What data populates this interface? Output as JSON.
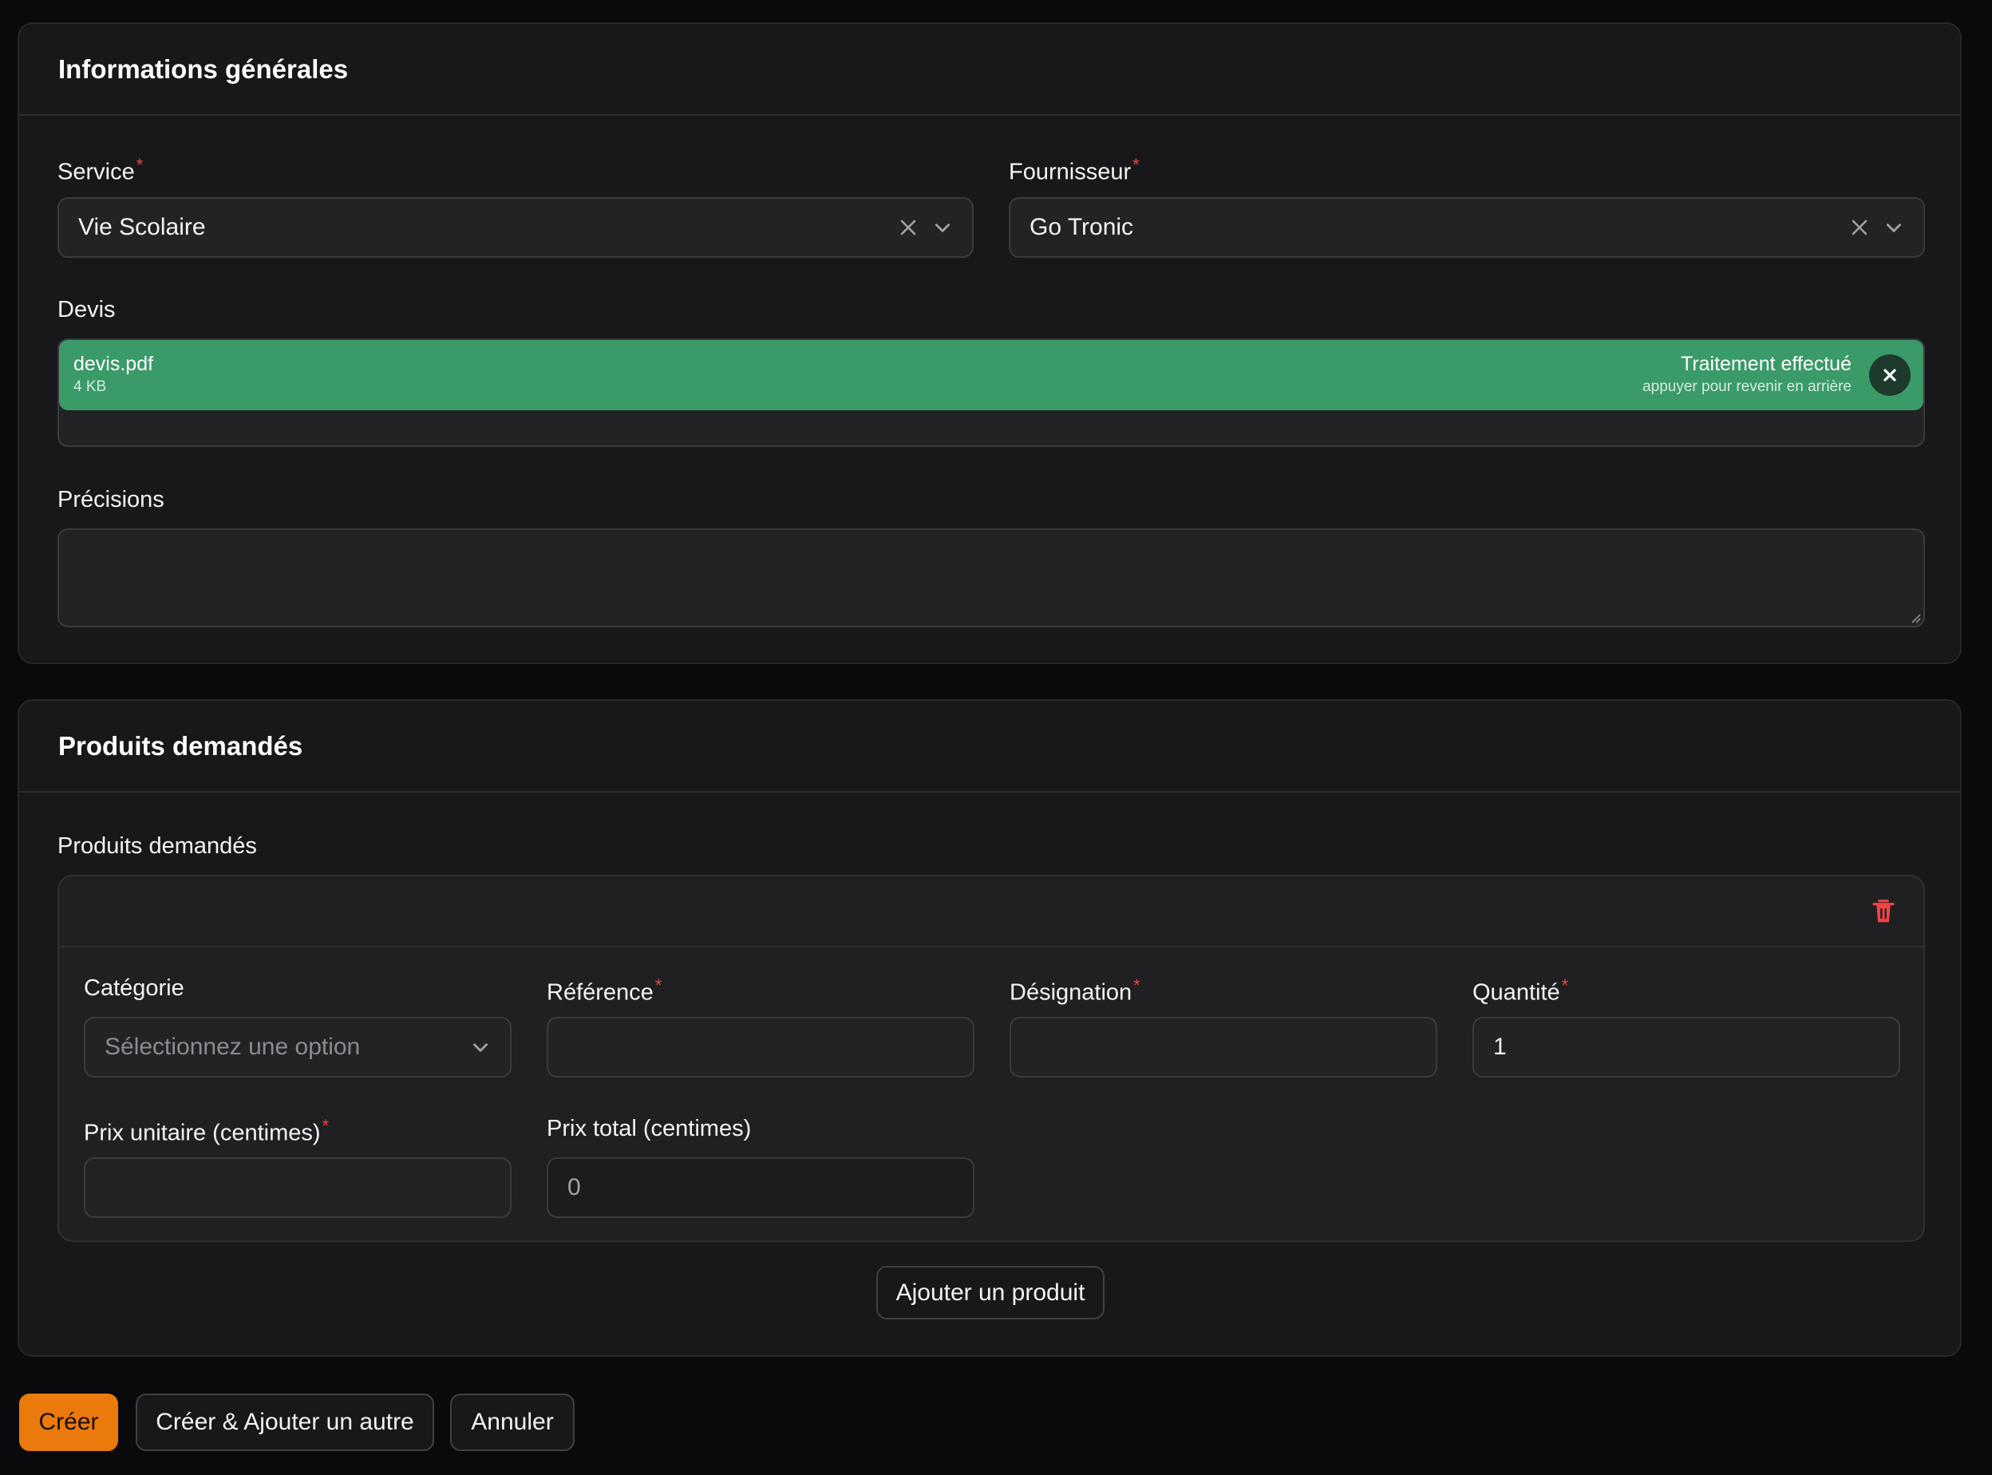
{
  "general": {
    "title": "Informations générales",
    "service": {
      "label": "Service",
      "required": "*",
      "value": "Vie Scolaire"
    },
    "supplier": {
      "label": "Fournisseur",
      "required": "*",
      "value": "Go Tronic"
    },
    "quote": {
      "label": "Devis",
      "file_name": "devis.pdf",
      "file_size": "4 KB",
      "status": "Traitement effectué",
      "hint": "appuyer pour revenir en arrière"
    },
    "details": {
      "label": "Précisions",
      "value": ""
    }
  },
  "products": {
    "title": "Produits demandés",
    "repeater_label": "Produits demandés",
    "item": {
      "category": {
        "label": "Catégorie",
        "placeholder": "Sélectionnez une option"
      },
      "reference": {
        "label": "Référence",
        "required": "*",
        "value": ""
      },
      "designation": {
        "label": "Désignation",
        "required": "*",
        "value": ""
      },
      "quantity": {
        "label": "Quantité",
        "required": "*",
        "value": "1"
      },
      "unit_price": {
        "label": "Prix unitaire (centimes)",
        "required": "*",
        "value": ""
      },
      "total_price": {
        "label": "Prix total (centimes)",
        "value": "0"
      }
    },
    "add_button": "Ajouter un produit"
  },
  "actions": {
    "create": "Créer",
    "create_another": "Créer & Ajouter un autre",
    "cancel": "Annuler"
  },
  "colors": {
    "primary": "#ea7a0c",
    "success": "#3a9a68",
    "danger": "#ef4444"
  }
}
